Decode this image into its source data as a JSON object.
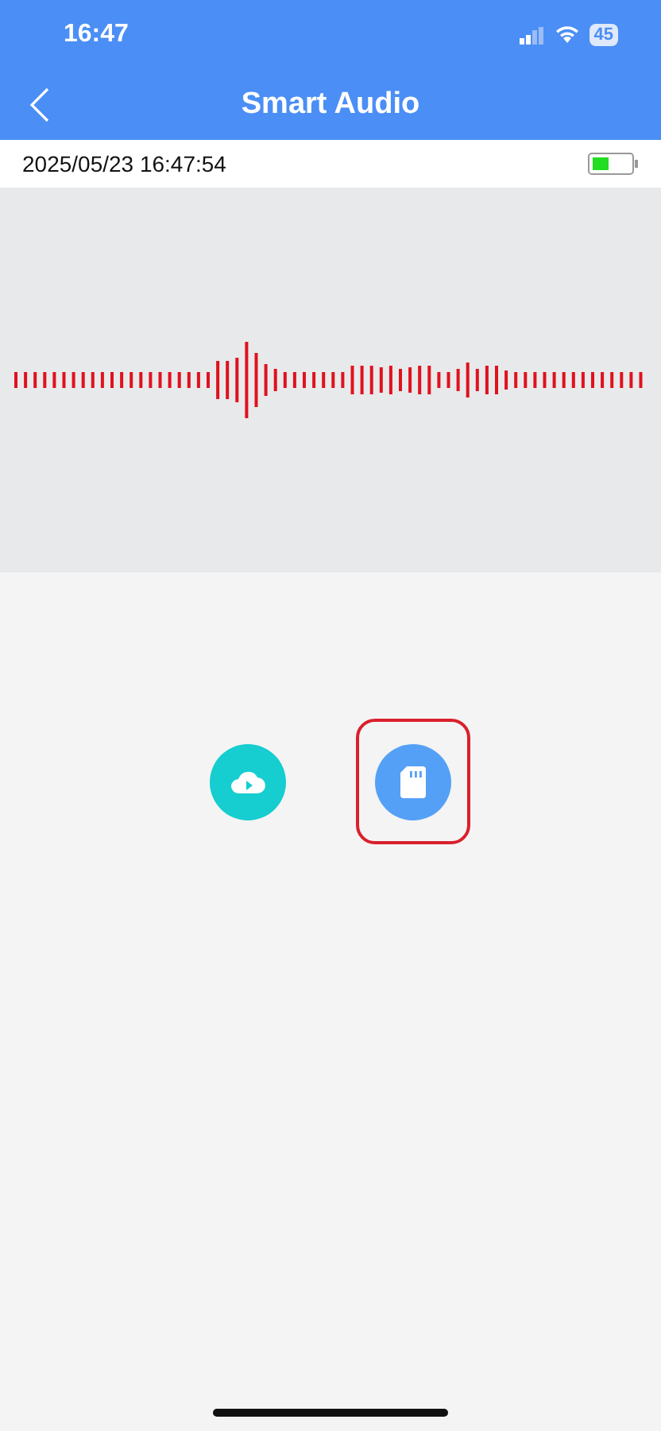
{
  "status_bar": {
    "time": "16:47",
    "battery": "45"
  },
  "nav": {
    "title": "Smart Audio"
  },
  "info": {
    "timestamp": "2025/05/23 16:47:54"
  },
  "actions": [
    {
      "kind": "cloud",
      "highlighted": false
    },
    {
      "kind": "sdcard",
      "highlighted": true
    }
  ]
}
